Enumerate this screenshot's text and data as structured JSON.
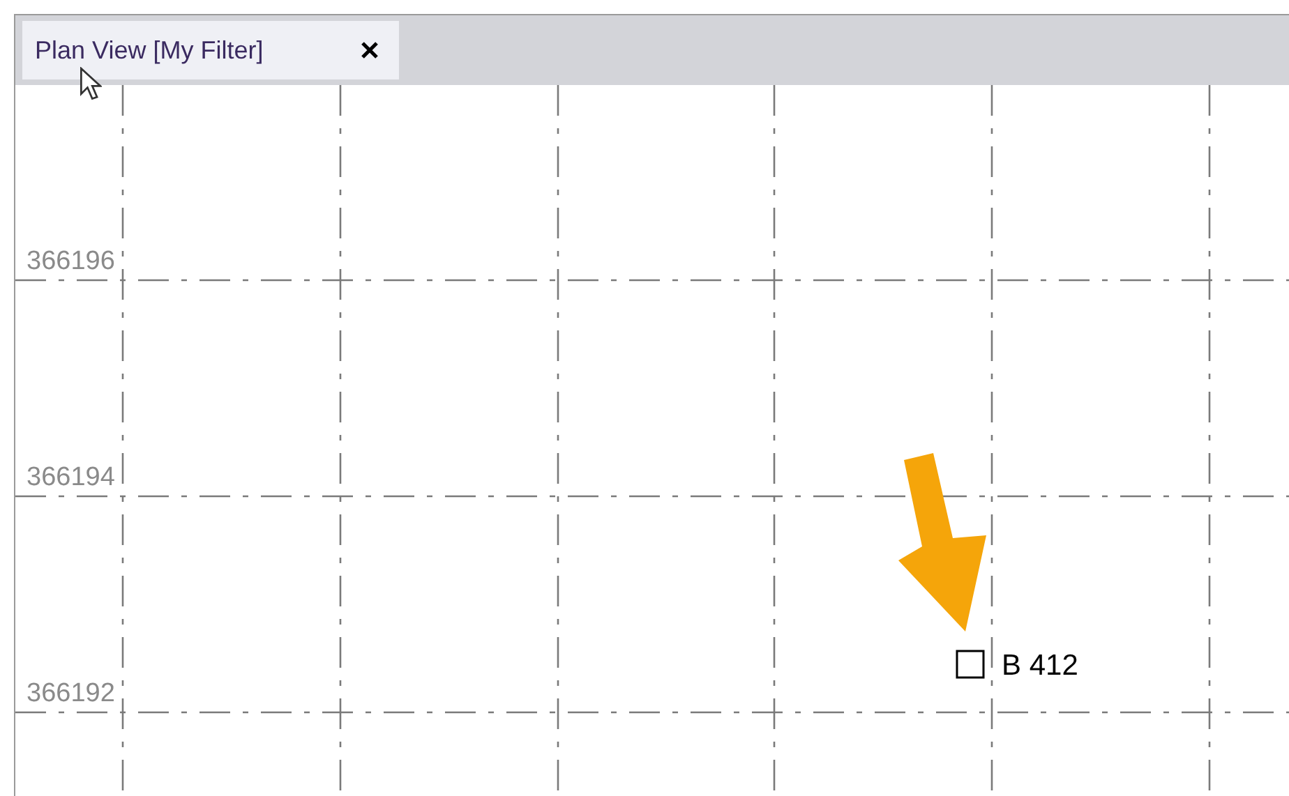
{
  "tabs": [
    {
      "label": "Plan View [My Filter]",
      "selected": true
    }
  ],
  "grid_labels": [
    "366196",
    "366194",
    "366192"
  ],
  "element": {
    "label": "B 412"
  }
}
